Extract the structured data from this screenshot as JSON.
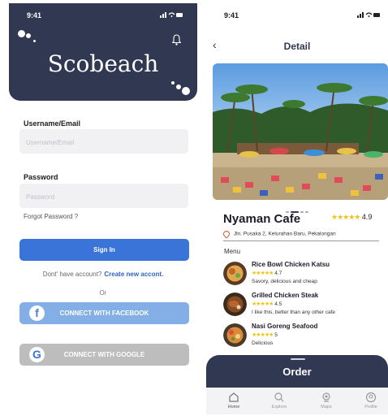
{
  "left": {
    "status": {
      "time": "9:41",
      "system_icons": "signal-wifi-battery-icons"
    },
    "brand": "Scobeach",
    "username": {
      "label": "Username/Email",
      "placeholder": "Username/Email"
    },
    "password": {
      "label": "Password",
      "placeholder": "Password"
    },
    "forgot": "Forgot Password ?",
    "signin": "Sign In",
    "account_prompt": "Dont' have account?",
    "account_link": "Create new accont.",
    "or": "Or",
    "facebook": {
      "label": "CONNECT WITH FACEBOOK",
      "icon": "facebook-icon",
      "color": "#83aee6"
    },
    "google": {
      "label": "CONNECT WITH GOOGLE",
      "icon": "google-icon",
      "color": "#bdbdbd"
    },
    "header_color": "#303852",
    "signin_color": "#3a74d8"
  },
  "right": {
    "status": {
      "time": "9:41"
    },
    "title": "Detail",
    "cafe": {
      "name": "Nyaman Cafe",
      "rating": "4.9",
      "stars": 5
    },
    "address": "Jln. Pusaka 2, Kelurahan Baru, Pekalongan",
    "menu_label": "Menu",
    "items": [
      {
        "name": "Rice Bowl Chicken Katsu",
        "rating": "4.7",
        "desc": "Savory, delicious and cheap"
      },
      {
        "name": "Grilled Chicken Steak",
        "rating": "4.5",
        "desc": "I like this, better than any other cafe"
      },
      {
        "name": "Nasi Goreng Seafood",
        "rating": "5",
        "desc": "Delicious"
      }
    ],
    "order": "Order",
    "tabs": [
      {
        "label": "Home",
        "icon": "home-icon"
      },
      {
        "label": "Explore",
        "icon": "search-icon"
      },
      {
        "label": "Maps",
        "icon": "map-pin-icon"
      },
      {
        "label": "Profile",
        "icon": "profile-icon"
      }
    ],
    "star_color": "#f2c311"
  }
}
